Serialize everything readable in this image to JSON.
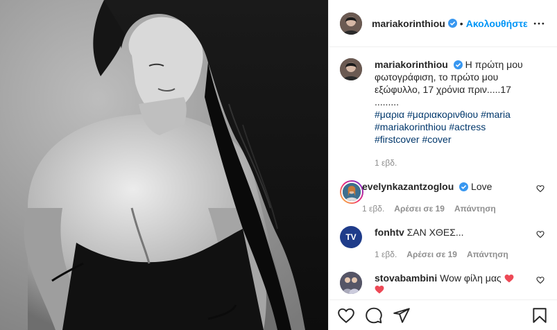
{
  "post": {
    "author": "mariakorinthiou",
    "follow_label": "Ακολουθήστε",
    "separator": "•"
  },
  "caption": {
    "username": "mariakorinthiou",
    "text": "Η πρώτη μου φωτογράφιση, το πρώτο μου εξώφυλλο, 17 χρόνια πριν.....17 .........",
    "hashtags": [
      "#μαρια",
      "#μαριακορινθιου",
      "#maria",
      "#mariakorinthiou",
      "#actress",
      "#firstcover",
      "#cover"
    ],
    "time": "1 εβδ."
  },
  "comments": [
    {
      "username": "evelynkazantzoglou",
      "verified": true,
      "text": "Love",
      "time": "1 εβδ.",
      "likes": "Αρέσει σε 19",
      "reply": "Απάντηση"
    },
    {
      "username": "fonhtv",
      "verified": false,
      "text": "ΣΑΝ ΧΘΕΣ...",
      "time": "1 εβδ.",
      "likes": "Αρέσει σε 19",
      "reply": "Απάντηση",
      "avatar_text": "TV"
    },
    {
      "username": "stovabambini",
      "verified": false,
      "text": "Wow φίλη μας"
    }
  ],
  "colors": {
    "follow": "#0095f6",
    "hashtag": "#00376b",
    "heart": "#ed4956",
    "verified": "#3897f0"
  }
}
